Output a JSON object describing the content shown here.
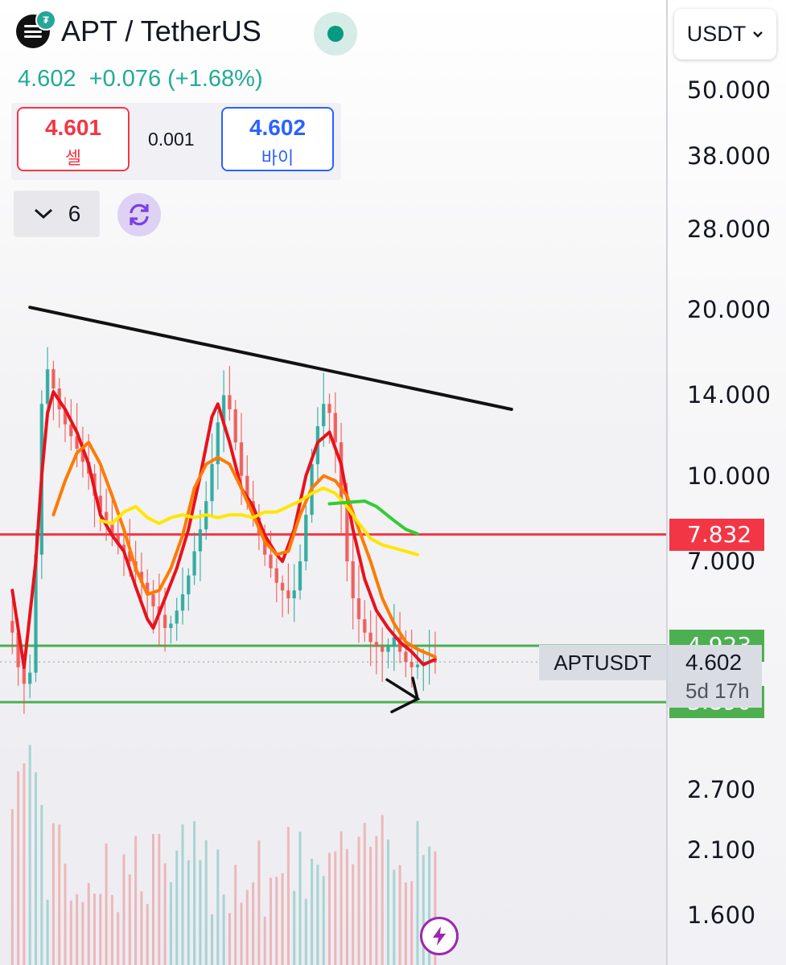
{
  "header": {
    "symbol_title": "APT / TetherUS",
    "coin_badge": "₮",
    "last_price": "4.602",
    "change": "+0.076 (+1.68%)"
  },
  "trade": {
    "sell_price": "4.601",
    "sell_label": "셀",
    "spread": "0.001",
    "buy_price": "4.602",
    "buy_label": "바이"
  },
  "indicators": {
    "count": "6"
  },
  "currency": {
    "selected": "USDT"
  },
  "colors": {
    "up": "#26a69a",
    "down": "#ef5350",
    "resistance": "#f23645",
    "support": "#4caf50",
    "trendline": "#111111",
    "ma_fast": "#e8121c",
    "ma_mid": "#ff7a00",
    "ma_slow": "#ffe600",
    "ma_long": "#33cc33"
  },
  "chart_data": {
    "type": "candlestick",
    "symbol": "APTUSDT",
    "scale": "log",
    "ylim": [
      1.4,
      60
    ],
    "y_ticks": [
      50,
      38,
      28,
      20,
      14,
      10,
      7,
      2.7,
      2.1,
      1.6
    ],
    "y_tick_labels": [
      "50.000",
      "38.000",
      "28.000",
      "20.000",
      "14.000",
      "10.000",
      "7.000",
      "2.700",
      "2.100",
      "1.600"
    ],
    "last_price": "4.602",
    "last_price_value": 4.602,
    "time_to_close": "5d 17h",
    "horizontal_lines": [
      {
        "label": "7.832",
        "value": 7.832,
        "kind": "resistance"
      },
      {
        "label": "4.923",
        "value": 4.923,
        "kind": "support"
      },
      {
        "label": "3.890",
        "value": 3.89,
        "kind": "support"
      }
    ],
    "trendline": [
      {
        "bar": 4,
        "price": 20.2
      },
      {
        "bar": 86,
        "price": 13.2
      }
    ],
    "bars": 73,
    "closes": [
      5.2,
      4.5,
      4.2,
      4.4,
      7.2,
      13.5,
      15.6,
      14.4,
      13.2,
      12.4,
      11.8,
      11.2,
      10.6,
      10.1,
      9.2,
      8.6,
      8.2,
      7.8,
      7.5,
      7.3,
      7.0,
      6.7,
      6.4,
      6.1,
      5.8,
      5.6,
      5.3,
      5.4,
      5.7,
      6.1,
      6.6,
      7.3,
      8.0,
      9.0,
      10.5,
      12.5,
      14.0,
      13.2,
      11.5,
      10.0,
      9.0,
      8.4,
      7.8,
      7.2,
      6.8,
      6.4,
      6.2,
      6.0,
      6.2,
      7.0,
      8.5,
      10.5,
      12.3,
      13.5,
      13.0,
      11.5,
      9.0,
      7.0,
      6.0,
      5.5,
      5.2,
      5.0,
      4.9,
      4.8,
      4.9,
      5.1,
      4.8,
      4.6,
      4.5,
      4.55,
      4.6,
      4.62,
      4.602
    ],
    "moving_averages": [
      {
        "name": "MA fast",
        "color": "#e8121c",
        "points": [
          [
            1,
            6.2
          ],
          [
            3,
            4.5
          ],
          [
            5,
            7.0
          ],
          [
            6,
            10.0
          ],
          [
            7,
            13.0
          ],
          [
            8,
            14.2
          ],
          [
            10,
            13.2
          ],
          [
            12,
            12.0
          ],
          [
            14,
            10.5
          ],
          [
            16,
            8.5
          ],
          [
            18,
            7.8
          ],
          [
            20,
            7.3
          ],
          [
            22,
            6.3
          ],
          [
            24,
            5.5
          ],
          [
            25,
            5.3
          ],
          [
            27,
            6.0
          ],
          [
            29,
            6.8
          ],
          [
            31,
            8.0
          ],
          [
            33,
            10.0
          ],
          [
            35,
            12.8
          ],
          [
            36,
            13.5
          ],
          [
            38,
            11.5
          ],
          [
            40,
            9.5
          ],
          [
            42,
            8.8
          ],
          [
            44,
            7.8
          ],
          [
            46,
            7.2
          ],
          [
            47,
            7.0
          ],
          [
            49,
            8.0
          ],
          [
            51,
            10.0
          ],
          [
            53,
            11.5
          ],
          [
            55,
            12.0
          ],
          [
            57,
            10.5
          ],
          [
            59,
            8.0
          ],
          [
            61,
            6.5
          ],
          [
            63,
            5.7
          ],
          [
            65,
            5.3
          ],
          [
            67,
            5.0
          ],
          [
            69,
            4.8
          ],
          [
            71,
            4.55
          ],
          [
            72,
            4.6
          ],
          [
            73,
            4.65
          ]
        ]
      },
      {
        "name": "MA mid",
        "color": "#ff7a00",
        "points": [
          [
            8,
            8.5
          ],
          [
            10,
            9.8
          ],
          [
            12,
            11.0
          ],
          [
            14,
            11.5
          ],
          [
            16,
            10.5
          ],
          [
            18,
            9.2
          ],
          [
            20,
            8.0
          ],
          [
            22,
            6.8
          ],
          [
            24,
            6.1
          ],
          [
            26,
            6.2
          ],
          [
            28,
            6.8
          ],
          [
            30,
            7.8
          ],
          [
            32,
            9.5
          ],
          [
            34,
            10.5
          ],
          [
            36,
            10.8
          ],
          [
            38,
            10.5
          ],
          [
            40,
            9.5
          ],
          [
            42,
            8.5
          ],
          [
            44,
            7.6
          ],
          [
            46,
            7.2
          ],
          [
            48,
            7.3
          ],
          [
            50,
            8.5
          ],
          [
            52,
            9.5
          ],
          [
            54,
            10.0
          ],
          [
            56,
            9.8
          ],
          [
            58,
            9.2
          ],
          [
            60,
            8.0
          ],
          [
            62,
            7.0
          ],
          [
            64,
            6.0
          ],
          [
            66,
            5.4
          ],
          [
            68,
            5.0
          ],
          [
            70,
            4.85
          ],
          [
            73,
            4.7
          ]
        ]
      },
      {
        "name": "MA slow",
        "color": "#ffe600",
        "points": [
          [
            16,
            8.3
          ],
          [
            18,
            8.2
          ],
          [
            20,
            8.6
          ],
          [
            22,
            8.8
          ],
          [
            24,
            8.4
          ],
          [
            26,
            8.2
          ],
          [
            28,
            8.4
          ],
          [
            30,
            8.5
          ],
          [
            32,
            8.4
          ],
          [
            34,
            8.5
          ],
          [
            36,
            8.4
          ],
          [
            38,
            8.5
          ],
          [
            40,
            8.5
          ],
          [
            42,
            8.4
          ],
          [
            44,
            8.6
          ],
          [
            46,
            8.6
          ],
          [
            48,
            8.8
          ],
          [
            50,
            9.0
          ],
          [
            52,
            9.3
          ],
          [
            54,
            9.5
          ],
          [
            56,
            9.3
          ],
          [
            58,
            8.8
          ],
          [
            60,
            8.2
          ],
          [
            62,
            7.7
          ],
          [
            64,
            7.5
          ],
          [
            66,
            7.4
          ],
          [
            68,
            7.3
          ],
          [
            70,
            7.2
          ]
        ]
      },
      {
        "name": "MA long",
        "color": "#33cc33",
        "points": [
          [
            55,
            8.9
          ],
          [
            58,
            8.95
          ],
          [
            61,
            9.0
          ],
          [
            63,
            8.8
          ],
          [
            66,
            8.3
          ],
          [
            68,
            8.0
          ],
          [
            70,
            7.85
          ]
        ]
      }
    ]
  }
}
